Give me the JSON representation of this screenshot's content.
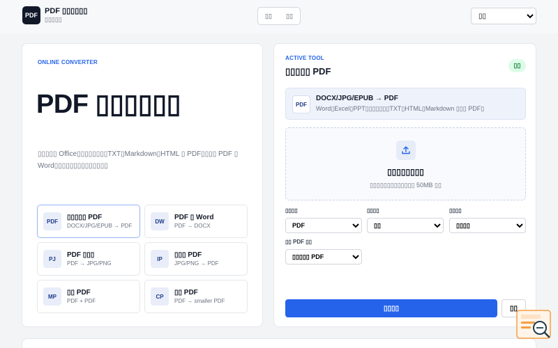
{
  "header": {
    "logo": "PDF",
    "title": "PDF ▯▯▯▯▯▯",
    "subtitle": "▯▯▯▯▯",
    "seg_a": "▯▯",
    "seg_b": "▯▯",
    "language": "▯▯"
  },
  "hero": {
    "kicker": "ONLINE CONVERTER",
    "title": "PDF ▯▯▯▯▯▯",
    "description": "▯▯▯▯▯ Office▯▯▯▯▯▯▯▯TXT▯Markdown▯HTML ▯ PDF▯▯▯▯ PDF ▯ Word▯▯▯▯▯▯▯▯▯▯▯▯▯▯"
  },
  "tools": [
    {
      "icon": "PDF",
      "title": "▯▯▯▯▯ PDF",
      "sub": "DOCX/JPG/EPUB → PDF"
    },
    {
      "icon": "DW",
      "title": "PDF ▯ Word",
      "sub": "PDF → DOCX"
    },
    {
      "icon": "PJ",
      "title": "PDF ▯▯▯",
      "sub": "PDF → JPG/PNG"
    },
    {
      "icon": "IP",
      "title": "▯▯▯ PDF",
      "sub": "JPG/PNG → PDF"
    },
    {
      "icon": "MP",
      "title": "▯▯ PDF",
      "sub": "PDF + PDF"
    },
    {
      "icon": "CP",
      "title": "▯▯ PDF",
      "sub": "PDF → smaller PDF"
    }
  ],
  "active": {
    "kicker": "ACTIVE TOOL",
    "title": "▯▯▯▯▯ PDF",
    "status": "▯▯",
    "tool_icon": "PDF",
    "tool_name": "DOCX/JPG/EPUB → PDF",
    "tool_formats": "Word▯Excel▯PPT▯▯▯▯▯▯▯TXT▯HTML▯Markdown ▯▯▯ PDF▯",
    "drop_title": "▯▯▯▯▯▯▯▯",
    "drop_hint": "▯▯▯▯▯▯▯▯▯▯▯▯▯ 50MB ▯▯"
  },
  "options": {
    "label_1": "▯▯▯▯",
    "value_1": "PDF",
    "label_2": "▯▯▯▯",
    "value_2": "▯▯",
    "label_3": "▯▯▯▯",
    "value_3": "▯▯▯▯",
    "label_4": "▯▯ PDF ▯▯",
    "value_4": "▯▯▯▯▯ PDF"
  },
  "actions": {
    "convert": "▯▯▯▯",
    "reset": "▯▯"
  },
  "colors": {
    "accent": "#2563eb",
    "status_bg": "#dcfce7"
  }
}
